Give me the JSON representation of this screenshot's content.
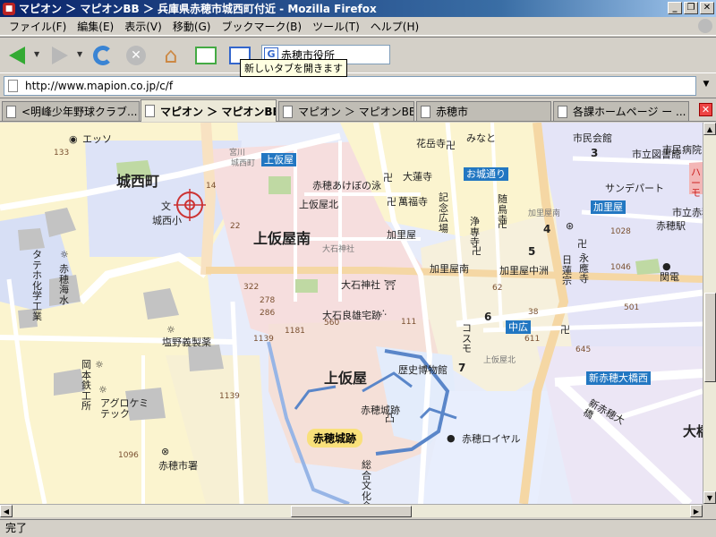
{
  "window": {
    "title": "マピオン ＞ マピオンBB ＞ 兵庫県赤穂市城西町付近 - Mozilla Firefox",
    "favicon": "mapion-icon",
    "controls": [
      "_",
      "❐",
      "✕"
    ]
  },
  "menu": [
    "ファイル(F)",
    "編集(E)",
    "表示(V)",
    "移動(G)",
    "ブックマーク(B)",
    "ツール(T)",
    "ヘルプ(H)"
  ],
  "toolbar": {
    "search_value": "赤穂市役所",
    "search_engine": "G",
    "tooltip": "新しいタブを開きます",
    "home_glyph": "⌂",
    "stop_glyph": "✕"
  },
  "url": {
    "value": "http://www.mapion.co.jp/c/f",
    "dropdown_glyph": "▼"
  },
  "tabs": [
    {
      "label": "<明峰少年野球クラブ..."
    },
    {
      "label": "マピオン ＞ マピオンBB..."
    },
    {
      "label": "マピオン ＞ マピオンBB ..."
    },
    {
      "label": "赤穂市"
    },
    {
      "label": "各課ホームページ ー ..."
    }
  ],
  "tab_close_glyph": "✕",
  "scroll_glyphs": {
    "up": "▲",
    "down": "▼",
    "left": "◀",
    "right": "▶"
  },
  "status": "完了",
  "map": {
    "districts": [
      "城西町",
      "上仮屋南",
      "上仮屋"
    ],
    "labels": [
      "上仮屋北",
      "加里屋南",
      "加里屋中洲",
      "赤穂あけぼの泳",
      "萬福寺",
      "大蓮寺",
      "花岳寺",
      "記念広場",
      "浄専寺",
      "随鳥寺",
      "城西小",
      "大石神社",
      "大石良雄宅跡",
      "歴史博物館",
      "赤穂城跡",
      "赤穂ロイヤル",
      "赤穂市署",
      "塩野義製薬",
      "アグロケミテック",
      "岡本鉄工所",
      "タテホ化学工業",
      "赤穂海水",
      "日蓮宗",
      "永應寺",
      "市民会館",
      "市立図書館",
      "サンデパート",
      "赤穂駅",
      "関電",
      "コスモ",
      "加里屋",
      "みなと",
      "エッソ",
      "新赤穂大橋",
      "総合文化会館",
      "大橋",
      "ハーモ",
      "市立赤穂",
      "市民病院"
    ],
    "stations": [
      "上仮屋",
      "お城通り",
      "加里屋",
      "中広",
      "新赤穂大橋西"
    ],
    "castle": "赤穂城跡",
    "chome": [
      "3",
      "4",
      "5",
      "6",
      "7"
    ],
    "numbers": [
      "133",
      "14",
      "22",
      "322",
      "278",
      "286",
      "1139",
      "1181",
      "560",
      "111",
      "1139",
      "1096",
      "62",
      "1028",
      "1046",
      "501",
      "611",
      "645",
      "38"
    ],
    "gray_labels": [
      "城西町",
      "上仮屋北"
    ],
    "small_labels": [
      "宮川",
      "大石神社",
      "加里屋南"
    ]
  }
}
